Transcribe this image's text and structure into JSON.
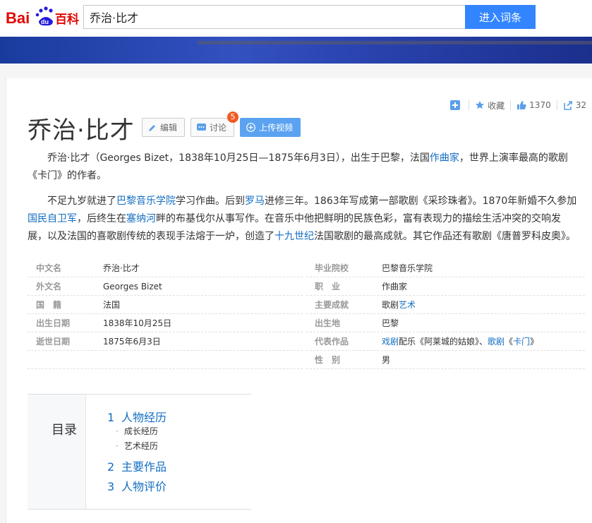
{
  "header": {
    "logo_text": "Bai du 百科",
    "search_value": "乔治·比才",
    "search_button": "进入词条"
  },
  "toolbar": {
    "collect": "收藏",
    "likes": "1370",
    "share_count": "32"
  },
  "article": {
    "title": "乔治·比才",
    "edit_label": "编辑",
    "discuss_label": "讨论",
    "discuss_badge": "5",
    "upload_label": "上传视频",
    "para1": {
      "a": "乔治·比才（Georges Bizet，1838年10月25日—1875年6月3日），出生于巴黎，法国",
      "link1": "作曲家",
      "b": "，世界上演率最高的歌剧《卡门》的作者。"
    },
    "para2": {
      "a": "不足九岁就进了",
      "link1": "巴黎音乐学院",
      "b": "学习作曲。后到",
      "link2": "罗马",
      "c": "进修三年。1863年写成第一部歌剧《采珍珠者》。1870年新婚不久参加",
      "link3": "国民自卫军",
      "d": "，后终生在",
      "link4": "塞纳河",
      "e": "畔的布基伐尔从事写作。在音乐中他把鲜明的民族色彩，富有表现力的描绘生活冲突的交响发展，以及法国的喜歌剧传统的表现手法熔于一炉，创造了",
      "link5": "十九世纪",
      "f": "法国歌剧的最高成就。其它作品还有歌剧《唐普罗科皮奥》。"
    }
  },
  "infobox": {
    "left": [
      {
        "key": "中文名",
        "value": "乔治·比才"
      },
      {
        "key": "外文名",
        "value": "Georges Bizet"
      },
      {
        "key": "国　籍",
        "value": "法国"
      },
      {
        "key": "出生日期",
        "value": "1838年10月25日"
      },
      {
        "key": "逝世日期",
        "value": "1875年6月3日"
      }
    ],
    "right": [
      {
        "key": "毕业院校",
        "value": "巴黎音乐学院"
      },
      {
        "key": "职　业",
        "value": "作曲家"
      },
      {
        "key": "主要成就",
        "value_a": "歌剧",
        "value_link": "艺术"
      },
      {
        "key": "出生地",
        "value": "巴黎"
      },
      {
        "key": "代表作品",
        "link1": "戏剧",
        "t1": "配乐《阿莱城的姑娘》、",
        "link2": "歌剧",
        "t2": "《",
        "link3": "卡门",
        "t3": "》"
      },
      {
        "key": "性　别",
        "value": "男"
      }
    ]
  },
  "toc": {
    "title": "目录",
    "items": [
      {
        "num": "1",
        "label": "人物经历"
      },
      {
        "sub": "成长经历"
      },
      {
        "sub": "艺术经历"
      },
      {
        "num": "2",
        "label": "主要作品"
      },
      {
        "num": "3",
        "label": "人物评价"
      }
    ]
  },
  "colors": {
    "link": "#136ec2",
    "search_button": "#3385ff",
    "badge": "#f15a22",
    "upload": "#5ba3f0"
  }
}
